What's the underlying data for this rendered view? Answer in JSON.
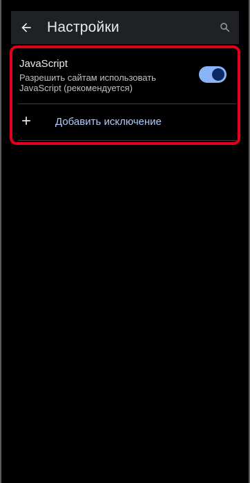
{
  "header": {
    "title": "Настройки",
    "back_icon": "arrow-back-icon",
    "search_icon": "search-icon"
  },
  "javascript_setting": {
    "title": "JavaScript",
    "description": "Разрешить сайтам использовать JavaScript (рекомендуется)",
    "enabled": true
  },
  "add_exception": {
    "label": "Добавить исключение",
    "icon": "plus-icon"
  },
  "colors": {
    "accent": "#8ab4f8",
    "highlight_border": "#e3001b",
    "background": "#000000",
    "appbar": "#202124"
  }
}
